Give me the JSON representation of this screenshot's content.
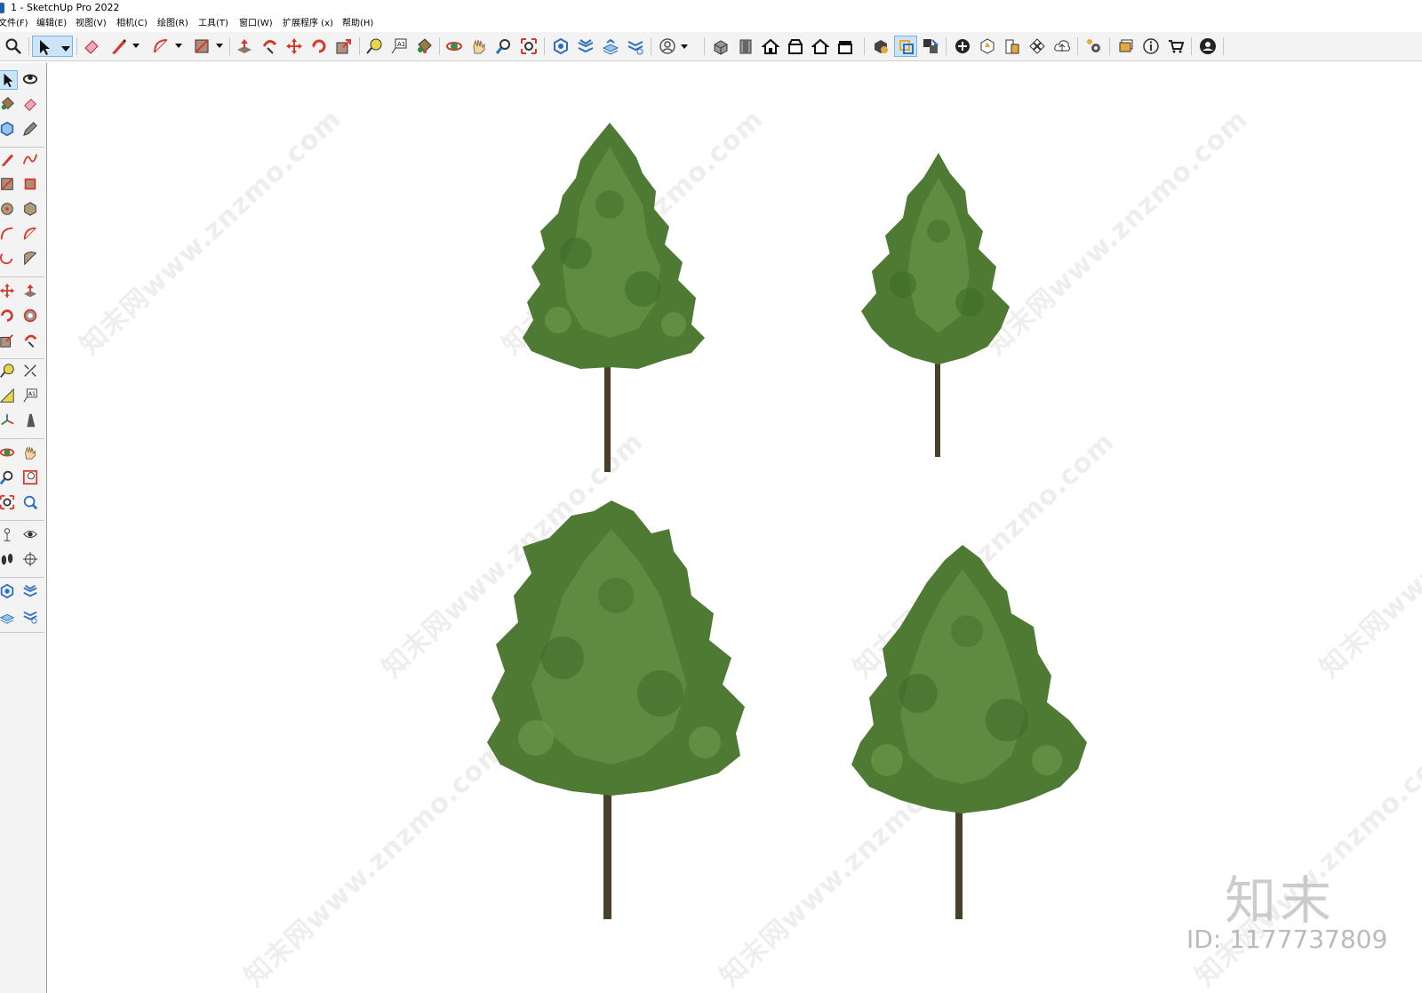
{
  "window": {
    "title": "1 - SketchUp Pro 2022"
  },
  "menu": [
    "文件(F)",
    "编辑(E)",
    "视图(V)",
    "相机(C)",
    "绘图(R)",
    "工具(T)",
    "窗口(W)",
    "扩展程序 (x)",
    "帮助(H)"
  ],
  "colors": {
    "accent": "#cce4f7",
    "foliage": "#4f7a34",
    "foliage_light": "#6f9a4e",
    "trunk": "#4a3f2a",
    "icon_red": "#d33a2c",
    "icon_blue": "#2a6ebd"
  },
  "top_toolbar_icons": [
    "search-icon",
    "select-icon",
    "dropdown-icon",
    "eraser-icon",
    "line-icon",
    "dropdown-icon",
    "arc-icon",
    "dropdown-icon",
    "shape-icon",
    "dropdown-icon",
    "push-pull-icon",
    "follow-me-icon",
    "move-icon",
    "rotate-icon",
    "scale-icon",
    "tape-measure-icon",
    "text-icon",
    "paint-bucket-icon",
    "orbit-icon",
    "pan-icon",
    "zoom-icon",
    "zoom-extents-icon",
    "sandbox-icon",
    "smoove-icon",
    "stamp-icon",
    "drape-icon",
    "profile-icon",
    "dropdown-icon",
    "iso-view-icon",
    "front-view-icon",
    "top-view-icon",
    "right-view-icon",
    "back-view-icon",
    "left-view-icon",
    "solid-tools-icon",
    "outer-shell-icon",
    "intersect-icon",
    "add-location-icon",
    "toggle-terrain-icon",
    "photo-texture-icon",
    "3d-warehouse-icon",
    "upload-icon",
    "extension-manager-icon",
    "section-plane-icon",
    "info-icon",
    "shop-icon",
    "account-icon"
  ],
  "left_toolbar_icons": [
    "select-icon",
    "orbit-icon",
    "paint-bucket-icon",
    "eraser-icon",
    "component-icon",
    "tag-icon",
    "line-icon",
    "freehand-icon",
    "rectangle-icon",
    "rotated-rectangle-icon",
    "circle-icon",
    "polygon-icon",
    "arc-icon",
    "two-point-arc-icon",
    "three-point-arc-icon",
    "pie-icon",
    "move-icon",
    "push-pull-icon",
    "rotate-icon",
    "follow-me-icon",
    "scale-icon",
    "offset-icon",
    "tape-measure-icon",
    "dimension-icon",
    "protractor-icon",
    "text-icon",
    "axes-icon",
    "3d-text-icon",
    "orbit-icon",
    "pan-icon",
    "zoom-icon",
    "zoom-window-icon",
    "zoom-extents-icon",
    "previous-view-icon",
    "position-camera-icon",
    "look-around-icon",
    "walk-icon",
    "section-plane-icon",
    "sandbox-icon",
    "smoove-icon",
    "stamp-icon",
    "drape-icon"
  ],
  "watermark": {
    "text": "知末网www.znzmo.com",
    "logo": "知末",
    "id": "ID: 1177737809"
  }
}
